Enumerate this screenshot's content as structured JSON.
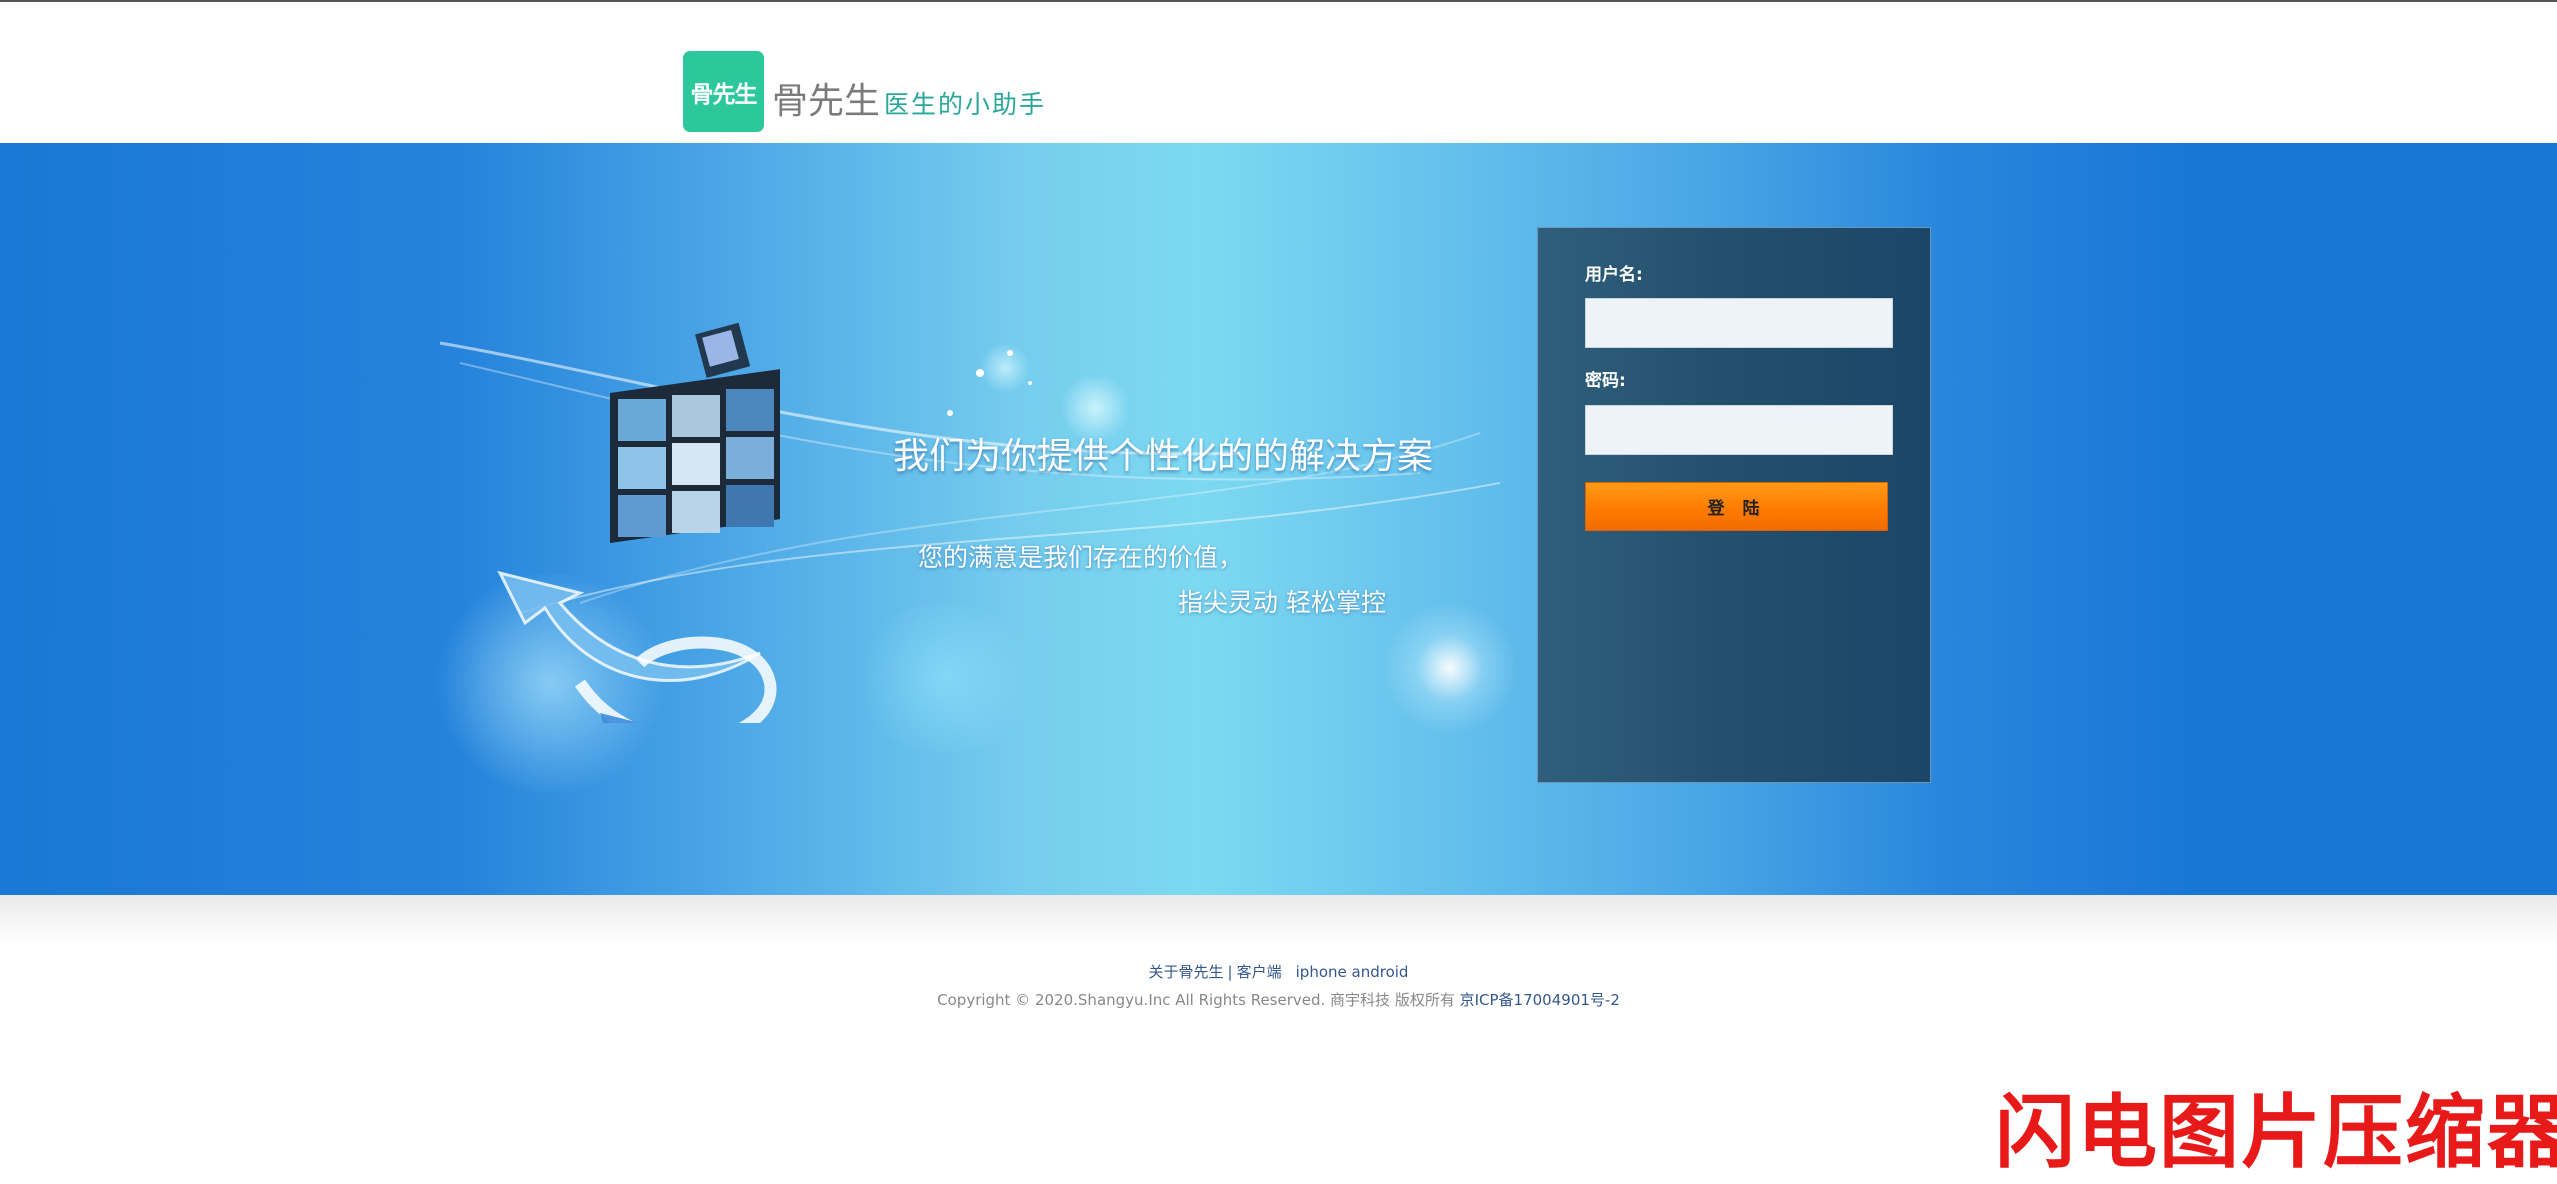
{
  "header": {
    "logo_badge_text": "骨先生",
    "logo_name": "骨先生",
    "tagline": "医生的小助手",
    "brand_color": "#2cc79a"
  },
  "banner": {
    "headline": "我们为你提供个性化的的解决方案",
    "subline_1": "您的满意是我们存在的价值，",
    "subline_2": "指尖灵动 轻松掌控"
  },
  "login": {
    "username_label": "用户名:",
    "username_value": "",
    "password_label": "密码:",
    "password_value": "",
    "submit_label": "登 陆",
    "accent_color": "#ff7c00"
  },
  "footer": {
    "about_link": "关于骨先生",
    "divider": "|",
    "client_link": "客户端",
    "iphone_link": "iphone",
    "android_link": "android",
    "copyright": "Copyright © 2020.Shangyu.Inc All Rights Reserved. 商宇科技 版权所有",
    "icp_link": "京ICP备17004901号-2"
  },
  "watermark": "闪电图片压缩器"
}
